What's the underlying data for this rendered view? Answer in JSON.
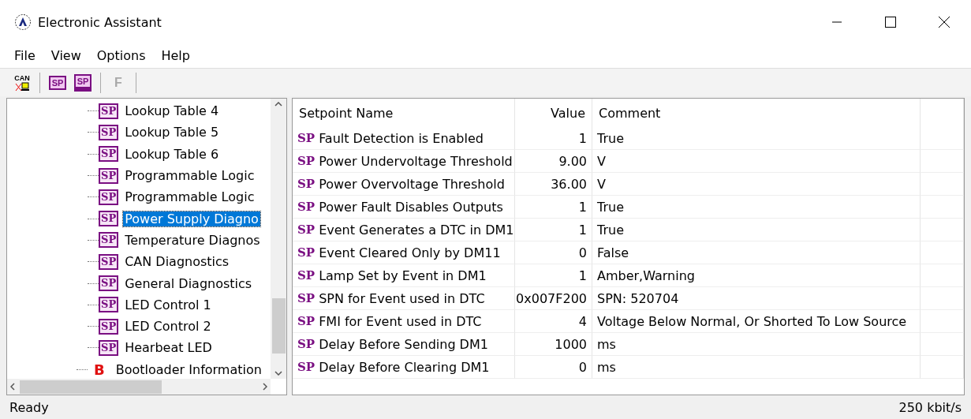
{
  "window": {
    "title": "Electronic Assistant"
  },
  "menu": [
    "File",
    "View",
    "Options",
    "Help"
  ],
  "toolbar": [
    {
      "kind": "can",
      "label": "CAN"
    },
    {
      "kind": "open",
      "label": "SP"
    },
    {
      "kind": "save",
      "label": "SP"
    },
    {
      "kind": "flash",
      "label": "F",
      "disabled": true
    }
  ],
  "tree": {
    "items": [
      {
        "kind": "sp",
        "badge": "SP",
        "label": "Lookup Table 4",
        "selected": false
      },
      {
        "kind": "sp",
        "badge": "SP",
        "label": "Lookup Table 5",
        "selected": false
      },
      {
        "kind": "sp",
        "badge": "SP",
        "label": "Lookup Table 6",
        "selected": false
      },
      {
        "kind": "sp",
        "badge": "SP",
        "label": "Programmable Logic",
        "selected": false
      },
      {
        "kind": "sp",
        "badge": "SP",
        "label": "Programmable Logic",
        "selected": false
      },
      {
        "kind": "sp",
        "badge": "SP",
        "label": "Power Supply Diagno",
        "selected": true
      },
      {
        "kind": "sp",
        "badge": "SP",
        "label": "Temperature Diagnos",
        "selected": false
      },
      {
        "kind": "sp",
        "badge": "SP",
        "label": "CAN Diagnostics",
        "selected": false
      },
      {
        "kind": "sp",
        "badge": "SP",
        "label": "General Diagnostics",
        "selected": false
      },
      {
        "kind": "sp",
        "badge": "SP",
        "label": "LED Control 1",
        "selected": false
      },
      {
        "kind": "sp",
        "badge": "SP",
        "label": "LED Control 2",
        "selected": false
      },
      {
        "kind": "sp",
        "badge": "SP",
        "label": "Hearbeat LED",
        "selected": false
      },
      {
        "kind": "boot",
        "badge": "B",
        "label": "Bootloader Information",
        "selected": false
      }
    ]
  },
  "table": {
    "columns": [
      "Setpoint Name",
      "Value",
      "Comment"
    ],
    "rows": [
      {
        "badge": "SP",
        "name": "Fault Detection is Enabled",
        "value": "1",
        "comment": "True"
      },
      {
        "badge": "SP",
        "name": "Power Undervoltage Threshold",
        "value": "9.00",
        "comment": "V"
      },
      {
        "badge": "SP",
        "name": "Power Overvoltage Threshold",
        "value": "36.00",
        "comment": "V"
      },
      {
        "badge": "SP",
        "name": "Power Fault Disables Outputs",
        "value": "1",
        "comment": "True"
      },
      {
        "badge": "SP",
        "name": "Event Generates a DTC in DM1",
        "value": "1",
        "comment": "True"
      },
      {
        "badge": "SP",
        "name": "Event Cleared Only by DM11",
        "value": "0",
        "comment": "False"
      },
      {
        "badge": "SP",
        "name": "Lamp Set by Event in DM1",
        "value": "1",
        "comment": "Amber,Warning"
      },
      {
        "badge": "SP",
        "name": "SPN for Event used in DTC",
        "value": "0x007F200",
        "comment": "SPN: 520704"
      },
      {
        "badge": "SP",
        "name": "FMI for Event used in DTC",
        "value": "4",
        "comment": "Voltage Below Normal, Or Shorted To Low Source"
      },
      {
        "badge": "SP",
        "name": "Delay Before Sending DM1",
        "value": "1000",
        "comment": "ms"
      },
      {
        "badge": "SP",
        "name": "Delay Before Clearing DM1",
        "value": "0",
        "comment": "ms"
      }
    ]
  },
  "status_bar": {
    "left": "Ready",
    "right": "250 kbit/s"
  }
}
